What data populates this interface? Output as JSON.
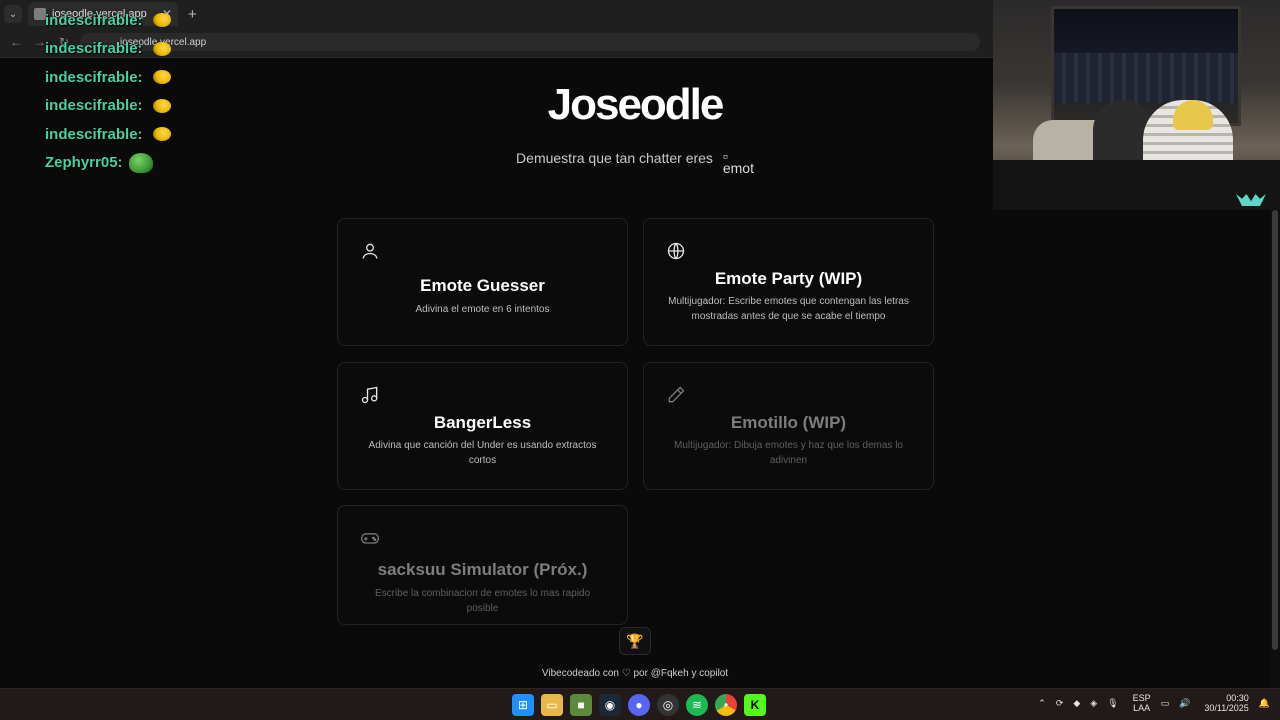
{
  "browser": {
    "tab_title": "joseodle.vercel.app",
    "url": "joseodle.vercel.app"
  },
  "chat": [
    {
      "user": "indescifrable:",
      "emote": "yellow-blob-emote"
    },
    {
      "user": "indescifrable:",
      "emote": "yellow-blob-emote"
    },
    {
      "user": "indescifrable:",
      "emote": "yellow-blob-emote"
    },
    {
      "user": "indescifrable:",
      "emote": "yellow-blob-emote"
    },
    {
      "user": "indescifrable:",
      "emote": "yellow-blob-emote"
    },
    {
      "user": "Zephyrr05:",
      "emote": "pepe-frog-emote"
    }
  ],
  "hero": {
    "title": "Joseodle",
    "subtitle": "Demuestra que tan chatter eres",
    "emote_alt": "emot"
  },
  "cards": [
    {
      "icon": "user-icon",
      "title": "Emote Guesser",
      "desc": "Adivina el emote en 6 intentos"
    },
    {
      "icon": "globe-icon",
      "title": "Emote Party (WIP)",
      "desc": "Multijugador: Escribe emotes que contengan las letras mostradas antes de que se acabe el tiempo"
    },
    {
      "icon": "music-note-icon",
      "title": "BangerLess",
      "desc": "Adivina que canción del Under es usando extractos cortos"
    },
    {
      "icon": "pencil-icon",
      "title": "Emotillo (WIP)",
      "desc": "Multijugador: Dibuja emotes y haz que los demas lo adivinen"
    },
    {
      "icon": "gamepad-icon",
      "title": "sacksuu Simulator (Próx.)",
      "desc": "Escribe la combinacion de emotes lo mas rapido posible"
    }
  ],
  "footer": {
    "text": "Vibecodeado con ♡ por @Fqkeh y copilot"
  },
  "taskbar": {
    "lang": "ESP",
    "lang2": "LAA",
    "time": "00:30",
    "date": "30/11/2025"
  },
  "colors": {
    "background": "#0a0a0a",
    "chat_name": "#46d3a0",
    "trophy": "#e0b63a"
  }
}
